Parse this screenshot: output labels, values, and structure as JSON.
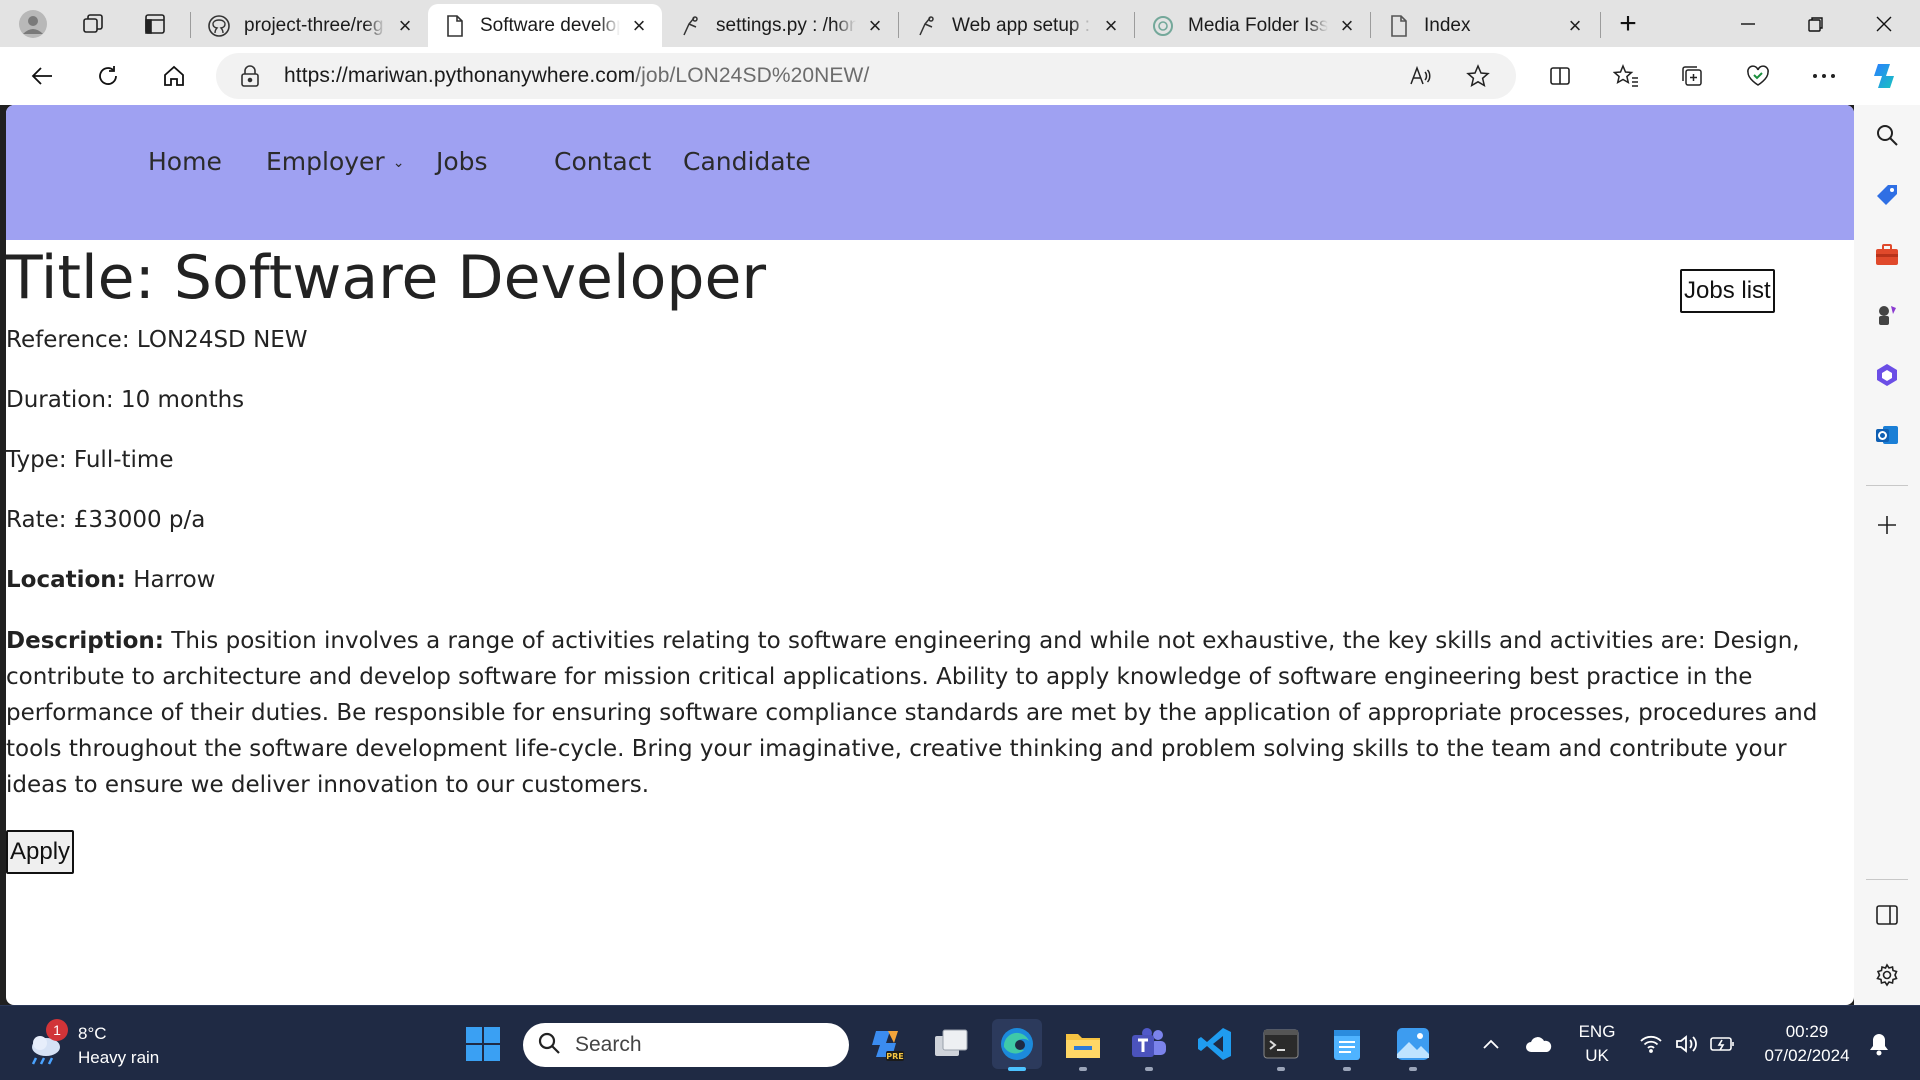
{
  "browser": {
    "tabs": [
      {
        "title": "project-three/reg",
        "icon": "github-icon",
        "active": false
      },
      {
        "title": "Software develop",
        "icon": "page-icon",
        "active": true
      },
      {
        "title": "settings.py : /hon",
        "icon": "pythonanywhere-icon",
        "active": false
      },
      {
        "title": "Web app setup : r",
        "icon": "pythonanywhere-icon",
        "active": false
      },
      {
        "title": "Media Folder Issu",
        "icon": "chatgpt-icon",
        "active": false
      },
      {
        "title": "Index",
        "icon": "page-icon",
        "active": false
      }
    ],
    "url_host": "https://mariwan.pythonanywhere.com",
    "url_path": "/job/LON24SD%20NEW/"
  },
  "nav": {
    "home": "Home",
    "employer": "Employer",
    "jobs": "Jobs",
    "contact": "Contact",
    "candidate": "Candidate"
  },
  "job": {
    "title": "Title: Software Developer",
    "jobs_list_button": "Jobs list",
    "reference": "Reference: LON24SD NEW",
    "duration": "Duration: 10 months",
    "type": "Type: Full-time",
    "rate": "Rate: £33000 p/a",
    "location_label": "Location:",
    "location_value": "Harrow",
    "description_label": "Description:",
    "description_text": "This position involves a range of activities relating to software engineering and while not exhaustive, the key skills and activities are: Design, contribute to architecture and develop software for mission critical applications. Ability to apply knowledge of software engineering best practice in the performance of their duties. Be responsible for ensuring software compliance standards are met by the application of appropriate processes, procedures and tools throughout the software development life-cycle. Bring your imaginative, creative thinking and problem solving skills to the team and contribute your ideas to ensure we deliver innovation to our customers.",
    "apply_button": "Apply"
  },
  "taskbar": {
    "weather_temp": "8°C",
    "weather_desc": "Heavy rain",
    "weather_badge": "1",
    "search_placeholder": "Search",
    "lang_line1": "ENG",
    "lang_line2": "UK",
    "time": "00:29",
    "date": "07/02/2024"
  },
  "colors": {
    "navbar_bg": "#9fa1f2",
    "taskbar_bg": "#1f2a44",
    "tabstrip_bg": "#e3e3e3"
  }
}
